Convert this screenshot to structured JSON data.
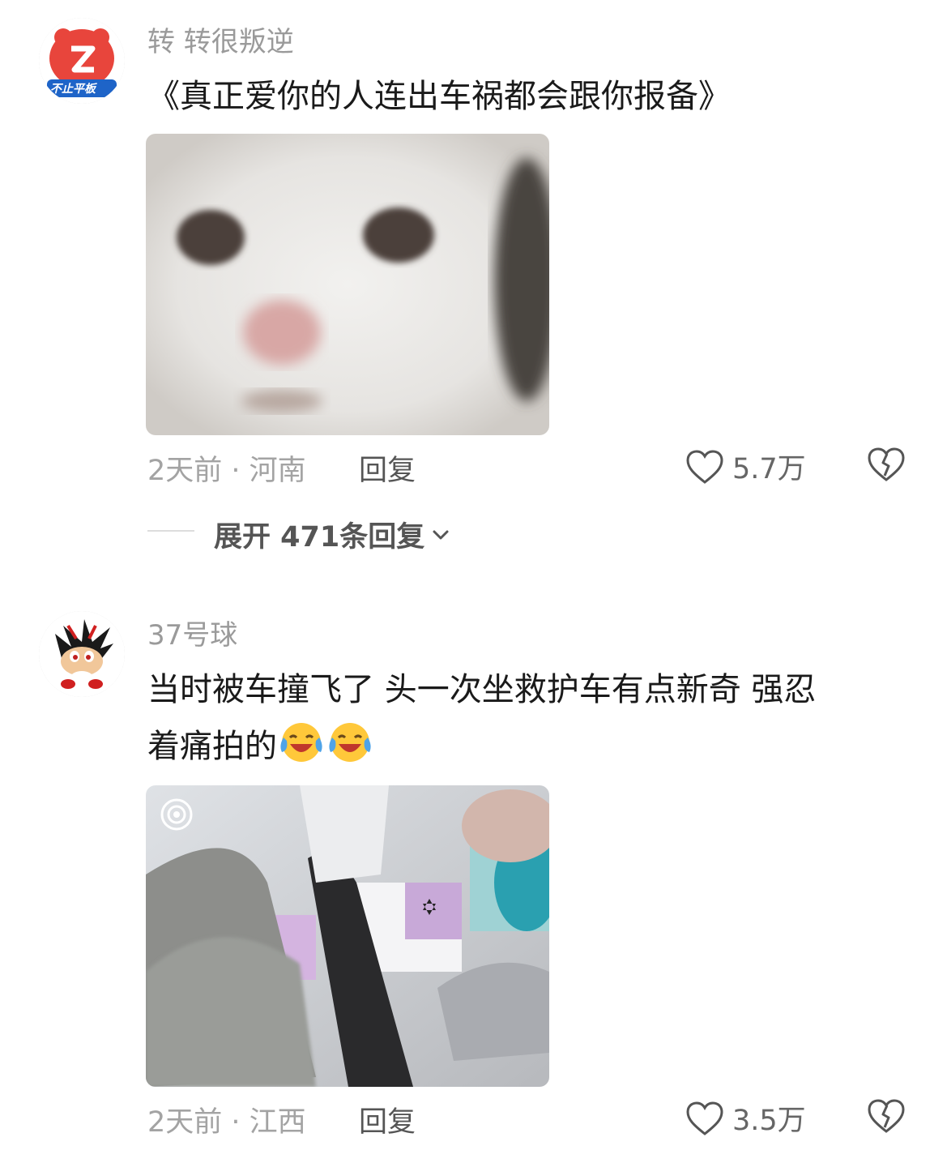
{
  "comments": [
    {
      "username": "转 转很叛逆",
      "avatar_badge": "不止平板",
      "text": "《真正爱你的人连出车祸都会跟你报备》",
      "image_desc_icon": "cat-photo",
      "meta": "2天前 · 河南",
      "reply_label": "回复",
      "likes": "5.7万",
      "expand_label": "展开 471条回复"
    },
    {
      "username": "37号球",
      "text_line1": "当时被车撞飞了 头一次坐救护车有点新奇 强忍",
      "text_line2": "着痛拍的",
      "image_desc_icon": "ambulance-photo",
      "meta": "2天前 · 江西",
      "reply_label": "回复",
      "likes": "3.5万"
    }
  ],
  "colors": {
    "meta_gray": "#a3a3a3",
    "text_dark": "#1a1a1a",
    "avatar_red": "#e8453c"
  }
}
